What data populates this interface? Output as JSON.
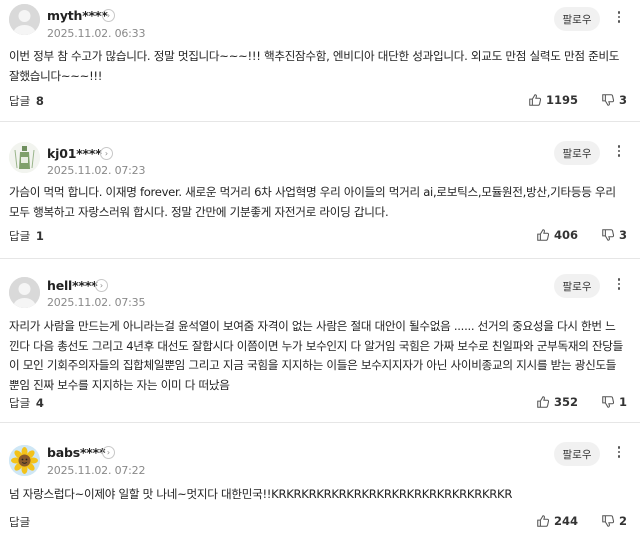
{
  "labels": {
    "follow": "팔로우",
    "reply": "답글"
  },
  "comments": [
    {
      "username": "myth****",
      "date": "2025.11.02. 06:33",
      "text": "이번 정부 참 수고가 많습니다. 정말 멋집니다~~~!!! 핵추진잠수함, 엔비디아 대단한 성과입니다. 외교도 만점 실력도 만점 준비도 잘했습니다~~~!!!",
      "replies": "8",
      "likes": "1195",
      "dislikes": "3",
      "avatar": "default-avatar"
    },
    {
      "username": "kj01****",
      "date": "2025.11.02. 07:23",
      "text": "가슴이 먹먹 합니다. 이재명 forever. 새로운 먹거리 6차 사업혁명 우리 아이들의 먹거리 ai,로보틱스,모듈원전,방산,기타등등 우리모두 행복하고 자랑스러워 합시다. 정말 간만에 기분좋게 자전거로 라이딩 갑니다.",
      "replies": "1",
      "likes": "406",
      "dislikes": "3",
      "avatar": "bottle-avatar"
    },
    {
      "username": "hell****",
      "date": "2025.11.02. 07:35",
      "text": "자리가 사람을 만드는게 아니라는걸 윤석열이 보여줌 자격이 없는 사람은 절대 대안이 될수없음 ...... 선거의 중요성을 다시 한번 느낀다 다음 총선도 그리고 4년후 대선도 잘합시다 이쯤이면 누가 보수인지 다 알거임 국힘은 가짜 보수로 친일파와 군부독재의 잔당들이 모인 기회주의자들의 집합체일뿐임 그리고 지금 국힘을 지지하는 이들은 보수지지자가 아닌 사이비종교의 지시를 받는 광신도들뿐임 진짜 보수를 지지하는 자는 이미 다 떠났음",
      "replies": "4",
      "likes": "352",
      "dislikes": "1",
      "avatar": "default-avatar"
    },
    {
      "username": "babs****",
      "date": "2025.11.02. 07:22",
      "text": "넘 자랑스럽다~이제야 일할 맛 나네~멋지다 대한민국!!KRKRKRKRKRKRKRKRKRKRKRKRKRKRKRKR",
      "replies": "",
      "likes": "244",
      "dislikes": "2",
      "avatar": "sunflower-avatar"
    }
  ]
}
